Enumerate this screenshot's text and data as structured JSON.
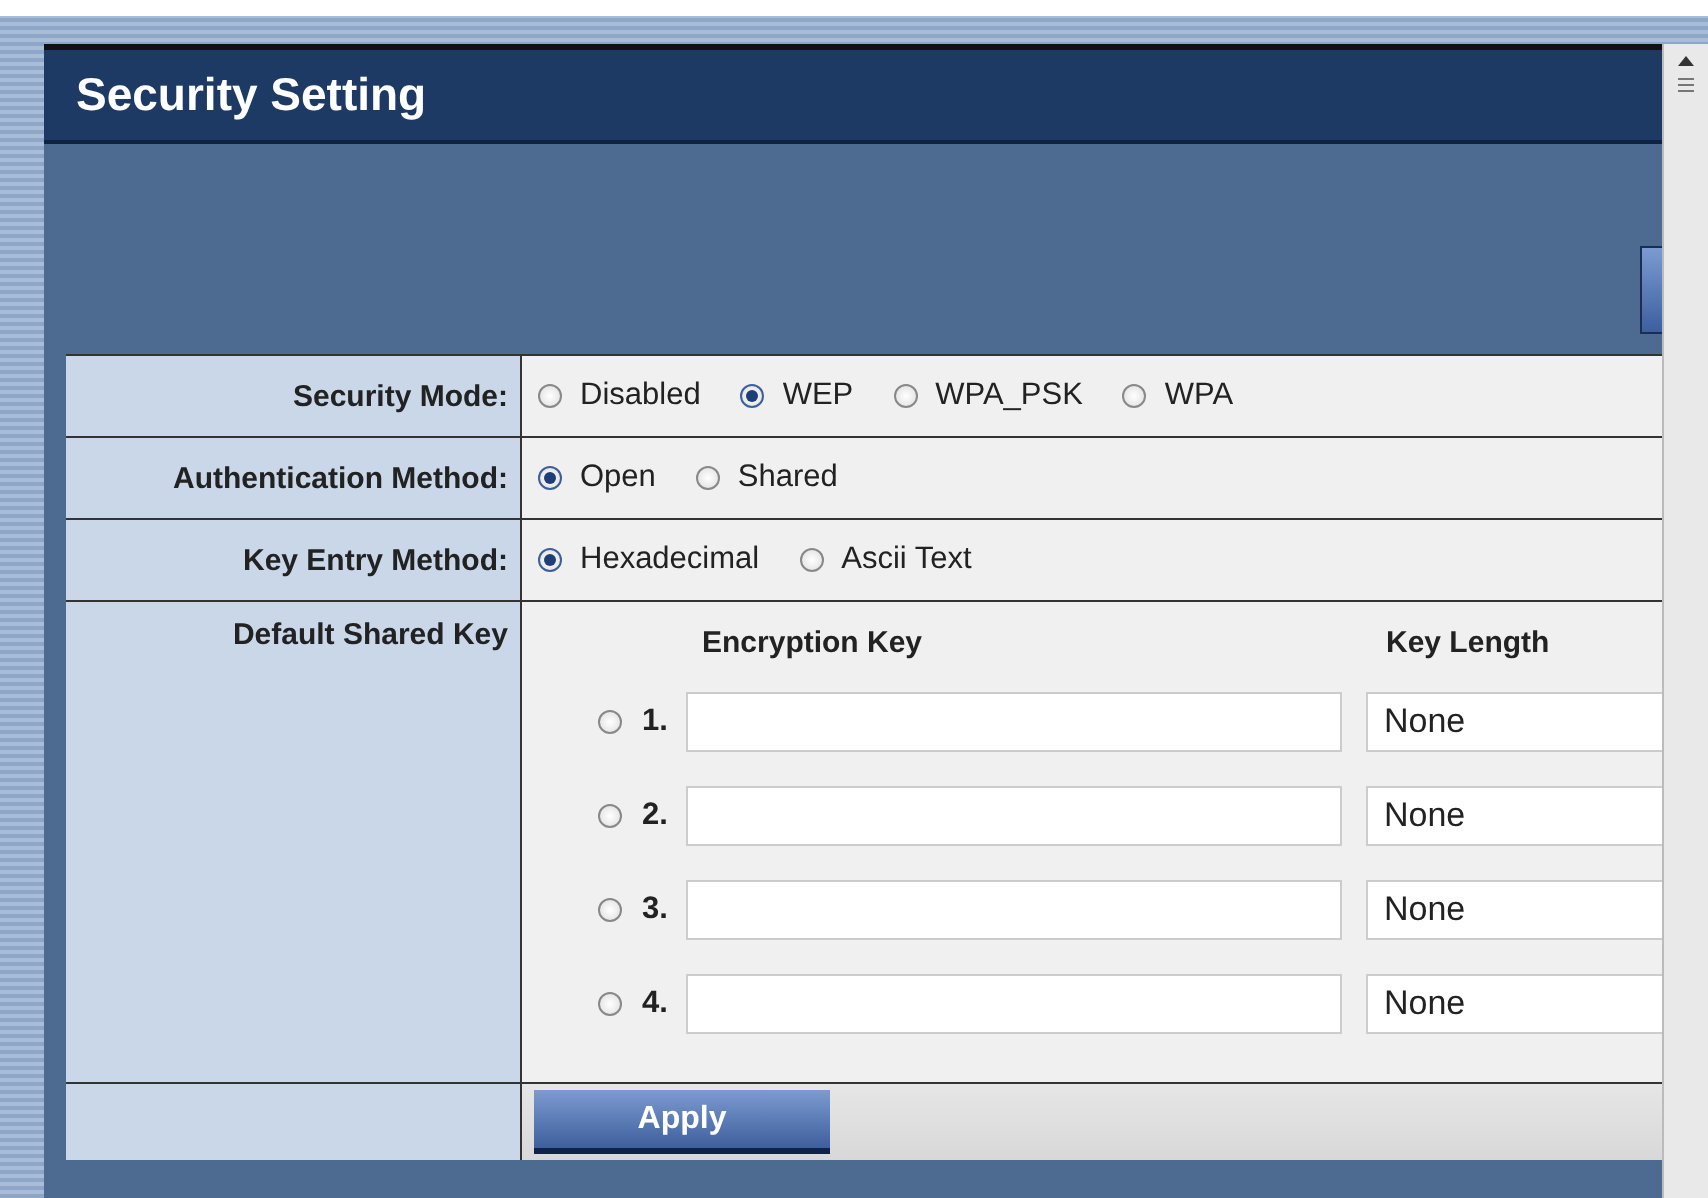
{
  "title": "Security Setting",
  "settings": [
    {
      "label": "Security Mode:",
      "options": [
        {
          "label": "Disabled",
          "selected": false
        },
        {
          "label": "WEP",
          "selected": true
        },
        {
          "label": "WPA_PSK",
          "selected": false
        },
        {
          "label": "WPA",
          "selected": false
        }
      ]
    },
    {
      "label": "Authentication Method:",
      "options": [
        {
          "label": "Open",
          "selected": true
        },
        {
          "label": "Shared",
          "selected": false
        }
      ]
    },
    {
      "label": "Key Entry Method:",
      "options": [
        {
          "label": "Hexadecimal",
          "selected": true
        },
        {
          "label": "Ascii Text",
          "selected": false
        }
      ]
    }
  ],
  "default_key": {
    "label": "Default Shared Key",
    "columns": [
      "Encryption Key",
      "Key Length"
    ],
    "keys": [
      {
        "number": "1.",
        "selected": false,
        "key_length": "None"
      },
      {
        "number": "2.",
        "selected": false,
        "key_length": "None"
      },
      {
        "number": "3.",
        "selected": false,
        "key_length": "None"
      },
      {
        "number": "4.",
        "selected": false,
        "key_length": "None"
      }
    ]
  },
  "apply_button": "Apply"
}
